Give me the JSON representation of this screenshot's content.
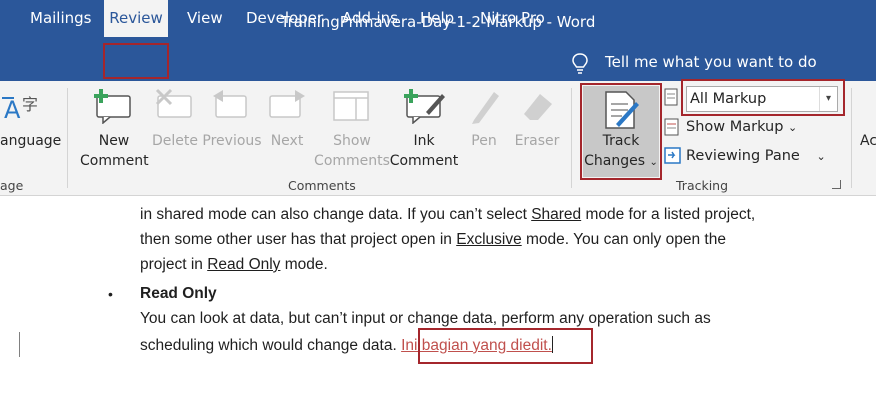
{
  "window": {
    "title": "TrainingPrimavera-Day-1-2-Markup  -  Word"
  },
  "tabs": [
    {
      "label": "Mailings"
    },
    {
      "label": "Review"
    },
    {
      "label": "View"
    },
    {
      "label": "Developer"
    },
    {
      "label": "Add-ins"
    },
    {
      "label": "Help"
    },
    {
      "label": "Nitro Pro"
    }
  ],
  "tell_me": "Tell me what you want to do",
  "ribbon": {
    "language": {
      "line1": "anguage",
      "group": "age"
    },
    "comments": {
      "new_comment": [
        "New",
        "Comment"
      ],
      "delete": "Delete",
      "previous": "Previous",
      "next": "Next",
      "show_comments": [
        "Show",
        "Comments"
      ],
      "ink_comment": [
        "Ink",
        "Comment"
      ],
      "pen": "Pen",
      "eraser": "Eraser",
      "group": "Comments"
    },
    "tracking": {
      "track_changes": [
        "Track",
        "Changes"
      ],
      "markup_select": "All Markup",
      "show_markup": "Show Markup",
      "reviewing_pane": "Reviewing Pane",
      "group": "Tracking"
    },
    "next_group_partial": "Ac"
  },
  "document": {
    "line1": "in shared mode can also change data. If you can’t select ",
    "line1_u": "Shared",
    "line1_end": " mode for a listed project,",
    "line2": "then some other user has that project open in ",
    "line2_u": "Exclusive",
    "line2_end": " mode. You can only open the",
    "line3": "project in ",
    "line3_u": "Read Only",
    "line3_end": " mode.",
    "bullet": "•",
    "bullet_title": "Read Only",
    "line4": "You can look at data, but can’t input or change data, perform any operation such as",
    "line5": "scheduling which would change data. ",
    "inserted": "Ini bagian yang diedit."
  },
  "colors": {
    "title_bar": "#2b579a",
    "highlight_box": "#a4262c",
    "insertion": "#c0504d"
  }
}
